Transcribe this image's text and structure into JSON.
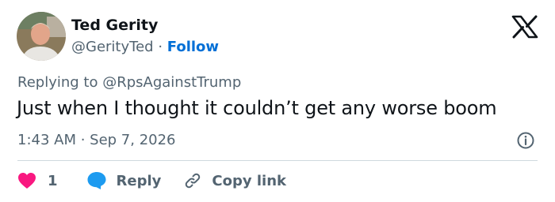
{
  "author": {
    "name": "Ted Gerity",
    "handle": "@GerityTed",
    "separator": "·",
    "follow_label": "Follow"
  },
  "brand_icon": "x-logo-icon",
  "tweet": {
    "replying_to": "Replying to @RpsAgainstTrump",
    "text": "Just when I thought it couldn’t get any worse boom",
    "timestamp": "1:43 AM · Sep 7, 2026"
  },
  "actions": {
    "like_count": "1",
    "reply_label": "Reply",
    "copy_label": "Copy link"
  },
  "colors": {
    "text": "#0f1419",
    "secondary": "#536471",
    "link": "#006fd6",
    "like": "#f91880",
    "reply": "#1d9bf0",
    "divider": "#cfd9de"
  }
}
